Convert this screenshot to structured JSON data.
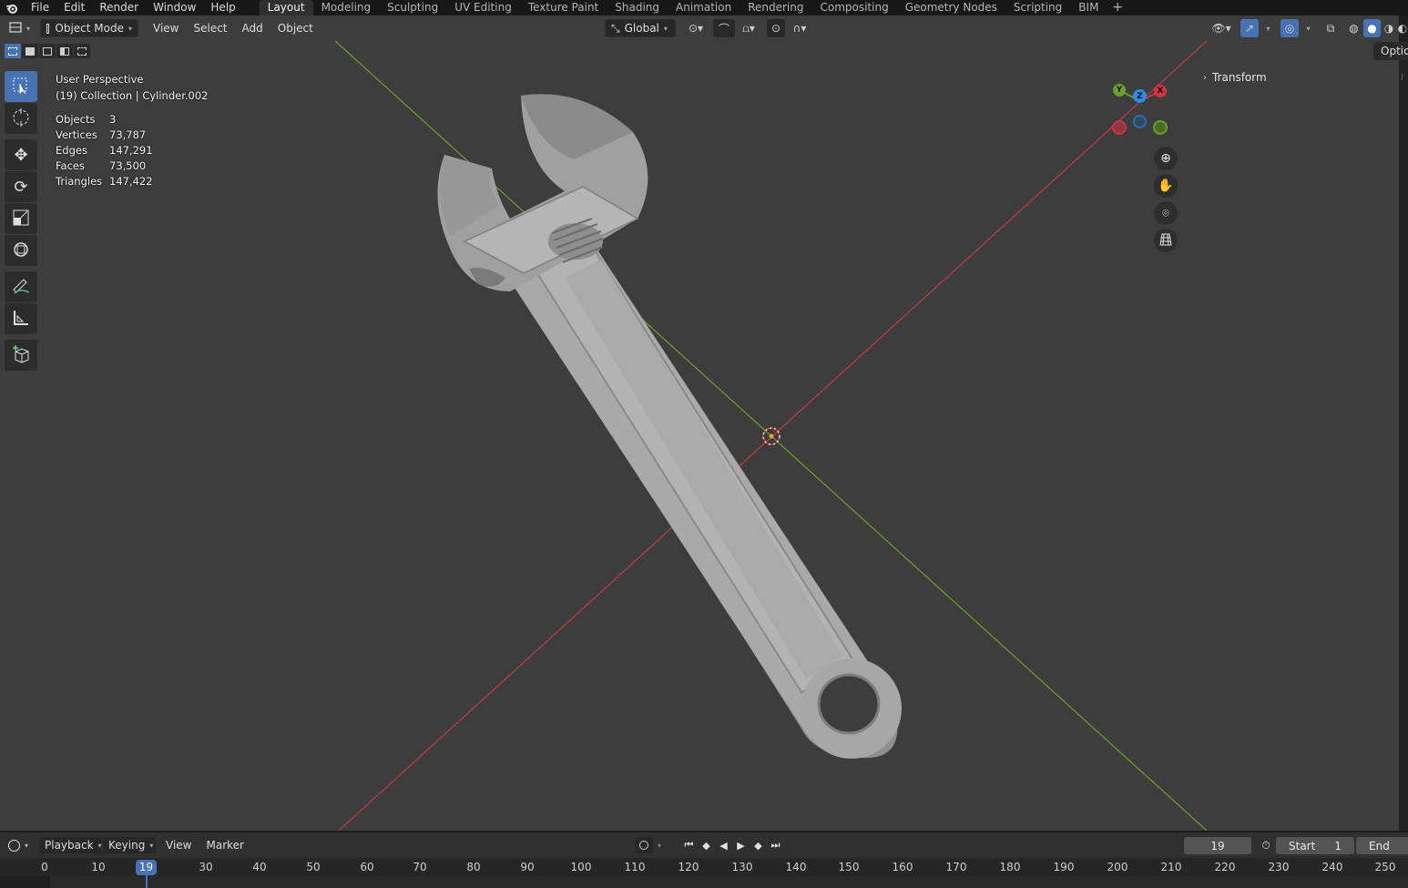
{
  "menu": {
    "items": [
      "File",
      "Edit",
      "Render",
      "Window",
      "Help"
    ]
  },
  "workspaces": {
    "tabs": [
      "Layout",
      "Modeling",
      "Sculpting",
      "UV Editing",
      "Texture Paint",
      "Shading",
      "Animation",
      "Rendering",
      "Compositing",
      "Geometry Nodes",
      "Scripting",
      "BIM"
    ],
    "active": "Layout",
    "add_label": "+"
  },
  "viewport_header": {
    "mode": "Object Mode",
    "menus": [
      "View",
      "Select",
      "Add",
      "Object"
    ],
    "orientation": "Global"
  },
  "overlay": {
    "view_name": "User Perspective",
    "collection_line": "(19) Collection | Cylinder.002",
    "stats": [
      {
        "label": "Objects",
        "value": "3"
      },
      {
        "label": "Vertices",
        "value": "73,787"
      },
      {
        "label": "Edges",
        "value": "147,291"
      },
      {
        "label": "Faces",
        "value": "73,500"
      },
      {
        "label": "Triangles",
        "value": "147,422"
      }
    ]
  },
  "gizmo": {
    "x": "X",
    "y": "Y",
    "z": "Z"
  },
  "sidebar": {
    "panel": "Transform",
    "options_tab": "Options"
  },
  "timeline": {
    "menus": [
      "Playback",
      "Keying",
      "View",
      "Marker"
    ],
    "current_frame": "19",
    "start_label": "Start",
    "start_value": "1",
    "end_label": "End",
    "ticks": [
      "0",
      "10",
      "20",
      "30",
      "40",
      "50",
      "60",
      "70",
      "80",
      "90",
      "100",
      "110",
      "120",
      "130",
      "140",
      "150",
      "160",
      "170",
      "180",
      "190",
      "200",
      "210",
      "220",
      "230",
      "240",
      "250"
    ]
  },
  "colors": {
    "accent": "#4772b3",
    "x_axis": "#d1323f",
    "y_axis": "#69a02a",
    "z_axis": "#2a8de3",
    "viewport_bg": "#3d3d3d"
  }
}
